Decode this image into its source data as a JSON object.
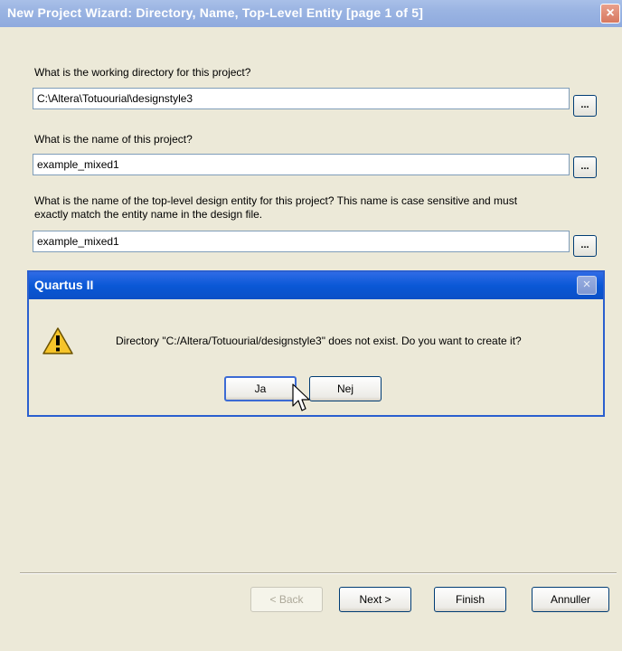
{
  "window": {
    "title": "New Project Wizard: Directory, Name, Top-Level Entity [page 1 of 5]",
    "close_label": "×"
  },
  "form": {
    "working_dir_label": "What is the working directory for this project?",
    "working_dir_value": "C:\\Altera\\Totuourial\\designstyle3",
    "project_name_label": "What is the name of this project?",
    "project_name_value": "example_mixed1",
    "top_level_label_line1": "What is the name of the top-level design entity for this project? This name is case sensitive and must",
    "top_level_label_line2": "exactly match the entity name in the design file.",
    "top_level_value": "example_mixed1",
    "browse_label": "..."
  },
  "dialog": {
    "title": "Quartus II",
    "close_label": "×",
    "icon": "warning-icon",
    "message": "Directory \"C:/Altera/Totuourial/designstyle3\" does not exist. Do you want to create it?",
    "yes_label": "Ja",
    "no_label": "Nej"
  },
  "footer": {
    "back_label": "< Back",
    "next_label": "Next >",
    "finish_label": "Finish",
    "cancel_label": "Annuller"
  },
  "colors": {
    "window_bg": "#ece9d8",
    "inactive_title": "#9ab4e2",
    "active_title": "#0a58d6",
    "close_red": "#d7785f"
  }
}
